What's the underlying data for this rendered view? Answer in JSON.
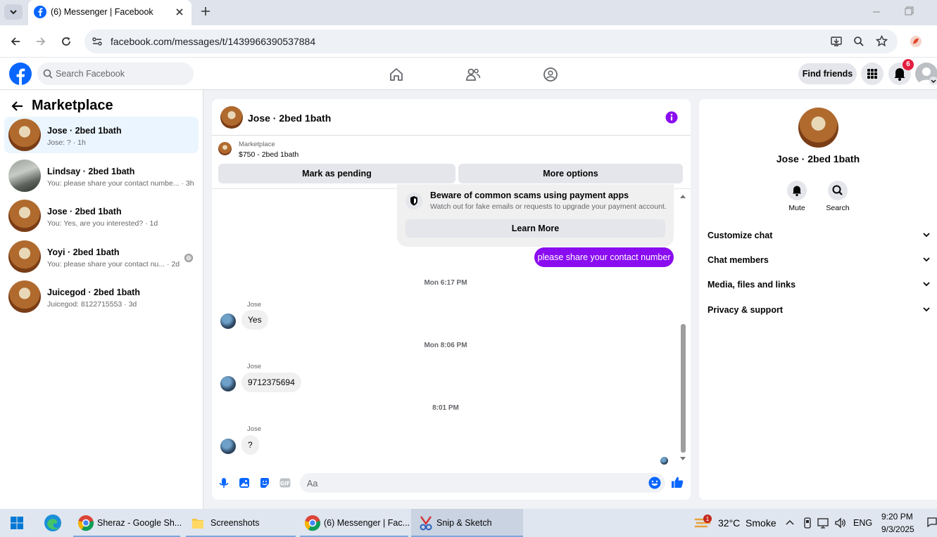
{
  "browser": {
    "tab_title": "(6) Messenger | Facebook",
    "url": "facebook.com/messages/t/1439966390537884"
  },
  "header": {
    "search_placeholder": "Search Facebook",
    "find_friends": "Find friends",
    "notification_count": "6"
  },
  "sidebar": {
    "title": "Marketplace",
    "conversations": [
      {
        "name": "Jose · 2bed 1bath",
        "preview": "Jose: ? · 1h",
        "avatar": "kitchen"
      },
      {
        "name": "Lindsay · 2bed 1bath",
        "preview": "You: please share your contact numbe... · 3h",
        "avatar": "room"
      },
      {
        "name": "Jose · 2bed 1bath",
        "preview": "You: Yes, are you interested? · 1d",
        "avatar": "kitchen"
      },
      {
        "name": "Yoyi · 2bed 1bath",
        "preview": "You: please share your contact nu... · 2d",
        "avatar": "kitchen"
      },
      {
        "name": "Juicegod · 2bed 1bath",
        "preview": "Juicegod: 8122715553 · 3d",
        "avatar": "kitchen"
      }
    ]
  },
  "chat": {
    "title": "Jose · 2bed 1bath",
    "listing_source": "Marketplace",
    "listing": "$750 - 2bed 1bath",
    "mark_pending": "Mark as pending",
    "more_options": "More options",
    "scam_title": "Beware of common scams using payment apps",
    "scam_body": "Watch out for fake emails or requests to upgrade your payment account.",
    "learn_more": "Learn More",
    "outgoing_message": "please share your contact number",
    "messages": [
      {
        "time": "Mon 6:17 PM",
        "sender": "Jose",
        "text": "Yes"
      },
      {
        "time": "Mon 8:06 PM",
        "sender": "Jose",
        "text": "9712375694"
      },
      {
        "time": "8:01 PM",
        "sender": "Jose",
        "text": "?"
      }
    ],
    "composer_placeholder": "Aa"
  },
  "details": {
    "name": "Jose · 2bed 1bath",
    "mute": "Mute",
    "search": "Search",
    "sections": [
      "Customize chat",
      "Chat members",
      "Media, files and links",
      "Privacy & support"
    ]
  },
  "taskbar": {
    "items": [
      "Sheraz - Google Sh...",
      "Screenshots",
      "(6) Messenger | Fac...",
      "Snip & Sketch"
    ],
    "weather": "32°C  Smoke",
    "weather_badge": "1",
    "language": "ENG",
    "time": "9:20 PM",
    "date": "9/3/2025"
  },
  "colors": {
    "brand": "#0866ff",
    "messenger_purple": "#8a0cf0",
    "active_row": "#ebf5ff",
    "badge_red": "#e41e3f"
  }
}
